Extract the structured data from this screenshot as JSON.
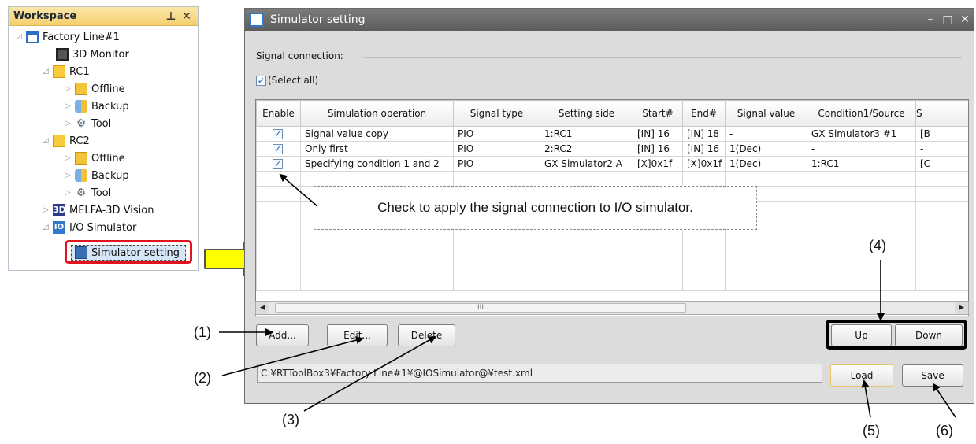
{
  "workspace": {
    "title": "Workspace",
    "pin_icon": "pin-icon",
    "close_icon": "close-icon",
    "tree": [
      {
        "label": "Factory Line#1",
        "icon": "factory-icon"
      },
      {
        "label": "3D Monitor",
        "icon": "monitor-icon"
      },
      {
        "label": "RC1",
        "icon": "robot-controller-icon"
      },
      {
        "label": "Offline",
        "icon": "offline-icon"
      },
      {
        "label": "Backup",
        "icon": "backup-icon"
      },
      {
        "label": "Tool",
        "icon": "tool-icon"
      },
      {
        "label": "RC2",
        "icon": "robot-controller-icon"
      },
      {
        "label": "Offline",
        "icon": "offline-icon"
      },
      {
        "label": "Backup",
        "icon": "backup-icon"
      },
      {
        "label": "Tool",
        "icon": "tool-icon"
      },
      {
        "label": "MELFA-3D Vision",
        "icon": "vision-3d-icon"
      },
      {
        "label": "I/O Simulator",
        "icon": "io-simulator-icon"
      },
      {
        "label": "Simulator setting",
        "icon": "simulator-setting-icon"
      }
    ],
    "icon_3d": "3D",
    "icon_io": "IO"
  },
  "dialog": {
    "title": "Simulator setting",
    "signal_connection_label": "Signal connection:",
    "select_all_label": "(Select all)",
    "columns": [
      "Enable",
      "Simulation operation",
      "Signal type",
      "Setting side",
      "Start#",
      "End#",
      "Signal value",
      "Condition1/Source",
      "S"
    ],
    "rows": [
      {
        "operation": "Signal value copy",
        "type": "PIO",
        "side": "1:RC1",
        "start": "[IN] 16",
        "end": "[IN] 18",
        "value": "-",
        "cond": "GX Simulator3 #1",
        "s": "[B"
      },
      {
        "operation": "Only first",
        "type": "PIO",
        "side": "2:RC2",
        "start": "[IN] 16",
        "end": "[IN] 16",
        "value": "1(Dec)",
        "cond": "-",
        "s": "-"
      },
      {
        "operation": "Specifying condition 1 and 2",
        "type": "PIO",
        "side": "GX Simulator2 A",
        "start": "[X]0x1f",
        "end": "[X]0x1f",
        "value": "1(Dec)",
        "cond": "1:RC1",
        "s": "[C"
      }
    ],
    "scroll_thumb_text": "III",
    "buttons": {
      "add": "Add...",
      "edit": "Edit...",
      "delete": "Delete",
      "up": "Up",
      "down": "Down",
      "load": "Load",
      "save": "Save"
    },
    "path": "C:¥RTToolBox3¥Factory Line#1¥@IOSimulator@¥test.xml"
  },
  "callout": "Check to apply the signal connection to I/O simulator.",
  "labels": {
    "l1": "(1)",
    "l2": "(2)",
    "l3": "(3)",
    "l4": "(4)",
    "l5": "(5)",
    "l6": "(6)"
  }
}
